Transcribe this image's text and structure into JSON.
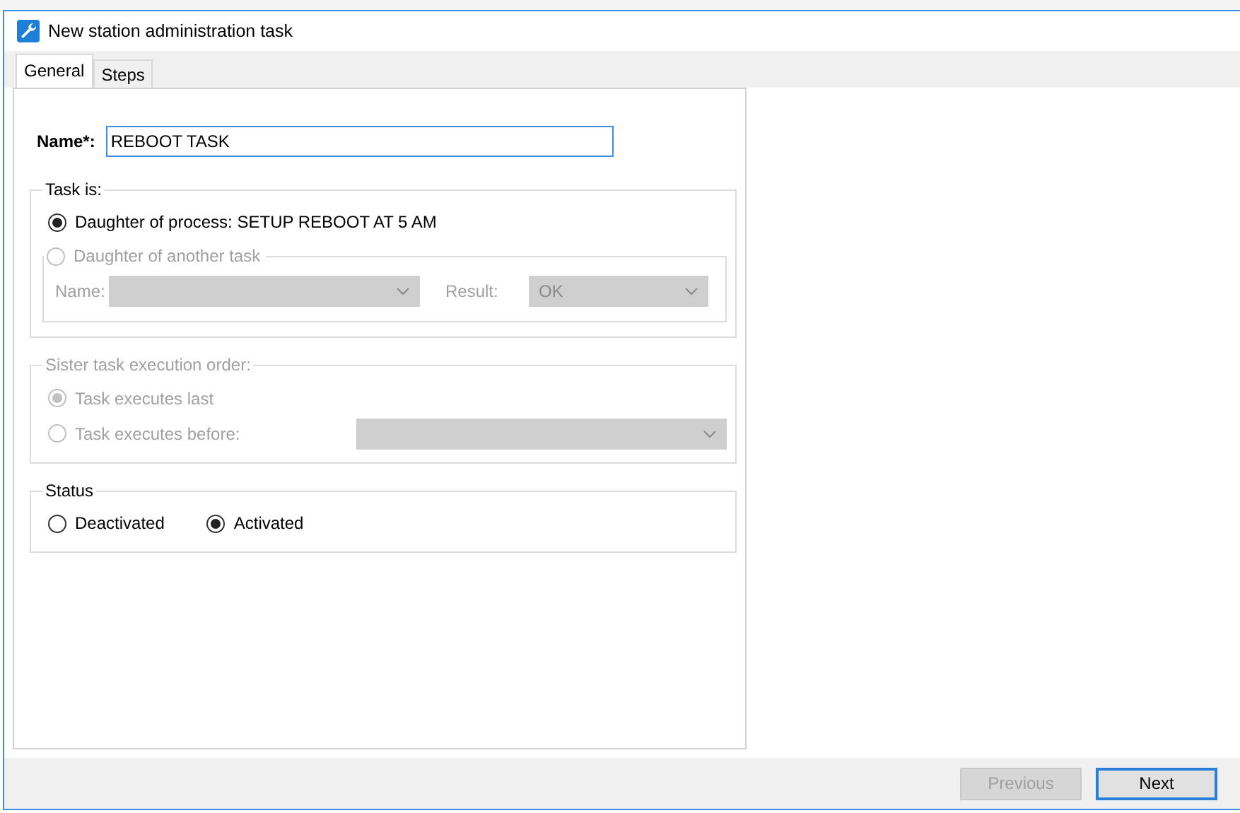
{
  "window": {
    "title": "New station administration task"
  },
  "tabs": [
    {
      "label": "General",
      "selected": true
    },
    {
      "label": "Steps",
      "selected": false
    }
  ],
  "name_field": {
    "label": "Name*:",
    "value": "REBOOT TASK"
  },
  "task_is": {
    "title": "Task is:",
    "options": [
      {
        "label": "Daughter of process: SETUP REBOOT AT 5 AM",
        "selected": true,
        "disabled": false
      },
      {
        "label": "Daughter of another task",
        "selected": false,
        "disabled": true
      }
    ],
    "another_task": {
      "disabled": true,
      "name_label": "Name:",
      "result_label": "Result:",
      "result_value": "OK"
    }
  },
  "sister_order": {
    "title": "Sister task execution order:",
    "disabled": true,
    "options": [
      {
        "label": "Task executes last",
        "selected": true
      },
      {
        "label": "Task executes before:",
        "selected": false
      }
    ]
  },
  "status": {
    "title": "Status",
    "options": [
      {
        "label": "Deactivated",
        "selected": false
      },
      {
        "label": "Activated",
        "selected": true
      }
    ]
  },
  "buttons": [
    {
      "label": "Previous",
      "disabled": true,
      "default": false
    },
    {
      "label": "Next",
      "disabled": false,
      "default": true
    }
  ]
}
